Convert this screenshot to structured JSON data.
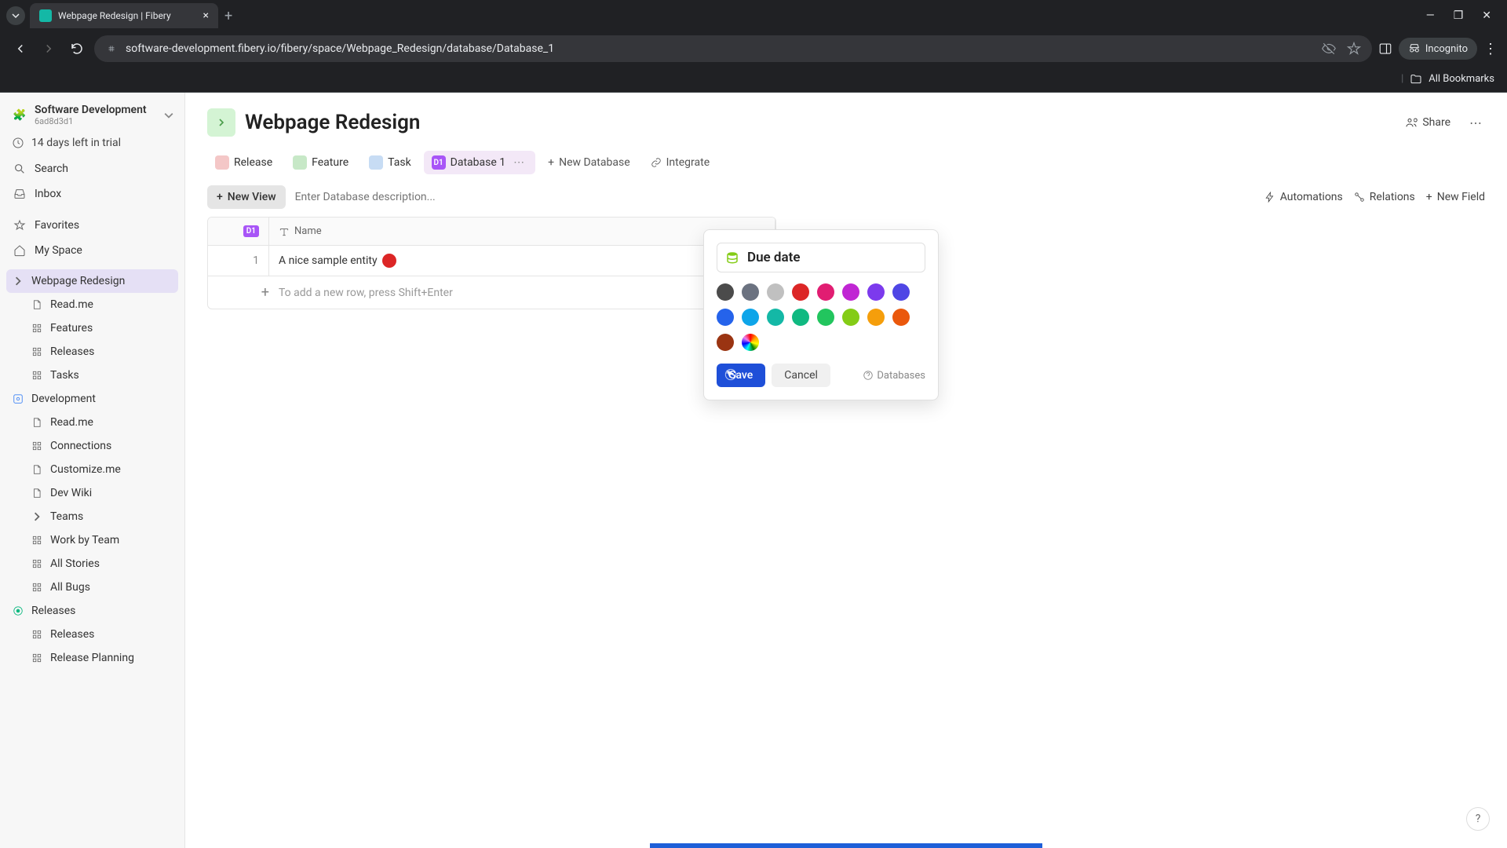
{
  "browser": {
    "tab_title": "Webpage Redesign | Fibery",
    "url": "software-development.fibery.io/fibery/space/Webpage_Redesign/database/Database_1",
    "incognito_label": "Incognito",
    "all_bookmarks": "All Bookmarks"
  },
  "workspace": {
    "name": "Software Development",
    "id": "6ad8d3d1",
    "trial_text": "14 days left in trial"
  },
  "sidebar": {
    "search": "Search",
    "inbox": "Inbox",
    "favorites": "Favorites",
    "my_space": "My Space",
    "tree": [
      {
        "label": "Webpage Redesign",
        "active": true,
        "children": [
          {
            "label": "Read.me",
            "icon": "doc"
          },
          {
            "label": "Features",
            "icon": "grid"
          },
          {
            "label": "Releases",
            "icon": "grid"
          },
          {
            "label": "Tasks",
            "icon": "grid"
          }
        ]
      },
      {
        "label": "Development",
        "icon": "dev",
        "children": [
          {
            "label": "Read.me",
            "icon": "doc"
          },
          {
            "label": "Connections",
            "icon": "grid"
          },
          {
            "label": "Customize.me",
            "icon": "doc"
          },
          {
            "label": "Dev Wiki",
            "icon": "doc"
          },
          {
            "label": "Teams",
            "icon": "chevron"
          },
          {
            "label": "Work by Team",
            "icon": "grid"
          },
          {
            "label": "All Stories",
            "icon": "grid"
          },
          {
            "label": "All Bugs",
            "icon": "grid"
          }
        ]
      },
      {
        "label": "Releases",
        "icon": "releases",
        "children": [
          {
            "label": "Releases",
            "icon": "grid"
          },
          {
            "label": "Release Planning",
            "icon": "grid"
          }
        ]
      }
    ]
  },
  "page": {
    "title": "Webpage Redesign",
    "share": "Share"
  },
  "db_tabs": [
    {
      "label": "Release",
      "color": "#f4c7c7",
      "code": ""
    },
    {
      "label": "Feature",
      "color": "#c7e8c7",
      "code": ""
    },
    {
      "label": "Task",
      "color": "#c7dcf4",
      "code": ""
    },
    {
      "label": "Database 1",
      "color": "#a855f7",
      "code": "D1",
      "active": true
    }
  ],
  "db_actions": {
    "new_database": "New Database",
    "integrate": "Integrate"
  },
  "toolbar": {
    "new_view": "New View",
    "description_placeholder": "Enter Database description...",
    "automations": "Automations",
    "relations": "Relations",
    "new_field": "New Field"
  },
  "table": {
    "badge": "D1",
    "name_header": "Name",
    "rows": [
      {
        "index": "1",
        "name": "A nice sample entity"
      }
    ],
    "add_row_text": "To add a new row, press Shift+Enter"
  },
  "popover": {
    "name_value": "Due date",
    "colors_row1": [
      "#4b4b4b",
      "#6b7280",
      "#c0c0c0",
      "#dc2626",
      "#e11d72",
      "#c026d3",
      "#7c3aed",
      "#4f46e5",
      "#2563eb"
    ],
    "colors_row2": [
      "#0ea5e9",
      "#14b8a6",
      "#10b981",
      "#22c55e",
      "#84cc16",
      "#f59e0b",
      "#ea580c",
      "#9a3412"
    ],
    "save": "Save",
    "cancel": "Cancel",
    "databases": "Databases"
  },
  "help": "?"
}
